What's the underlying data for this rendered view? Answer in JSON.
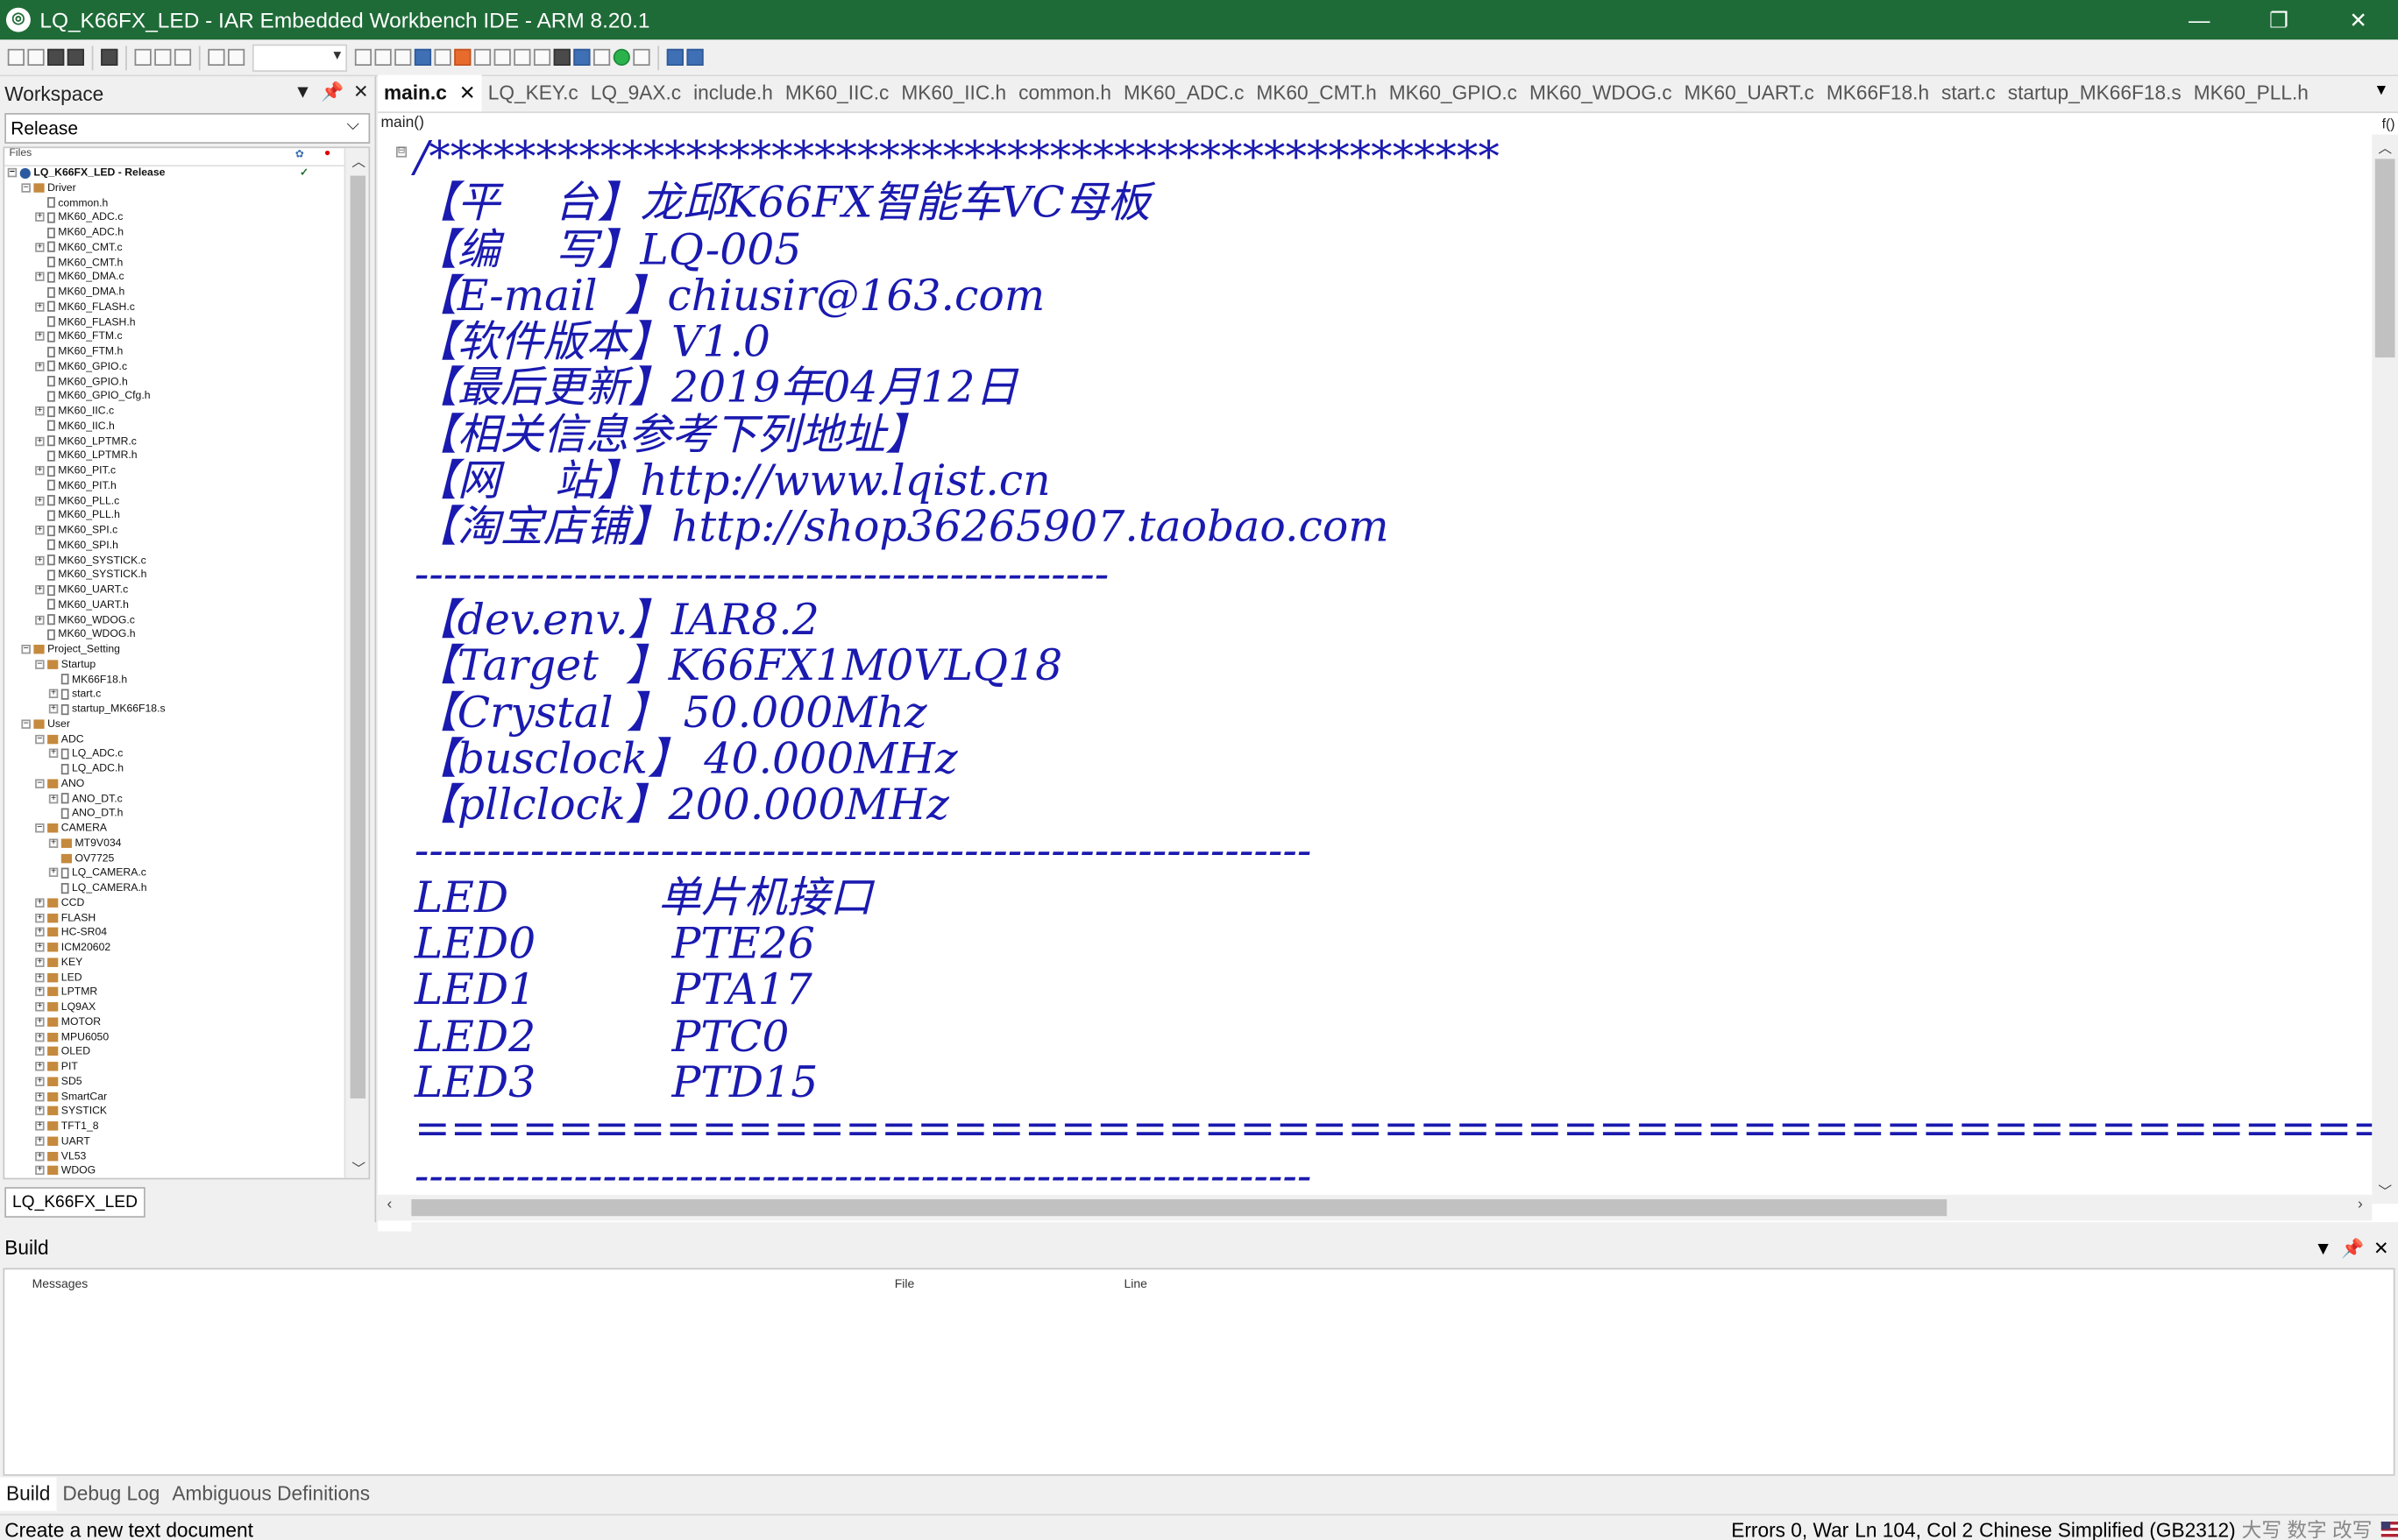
{
  "window": {
    "title": "LQ_K66FX_LED - IAR Embedded Workbench IDE - ARM 8.20.1",
    "controls": {
      "minimize": "—",
      "restore": "❐",
      "close": "✕"
    },
    "accent": "#1e6b37"
  },
  "workspace": {
    "title": "Workspace",
    "config": "Release",
    "files_header": "Files",
    "tab_label": "LQ_K66FX_LED",
    "tree": [
      {
        "label": "LQ_K66FX_LED - Release",
        "depth": 0,
        "kind": "project",
        "bold": true,
        "check": true
      },
      {
        "label": "Driver",
        "depth": 1,
        "kind": "folder",
        "exp": "⊟"
      },
      {
        "label": "common.h",
        "depth": 2,
        "kind": "doc"
      },
      {
        "label": "MK60_ADC.c",
        "depth": 2,
        "kind": "doc",
        "exp": "⊞"
      },
      {
        "label": "MK60_ADC.h",
        "depth": 2,
        "kind": "doc"
      },
      {
        "label": "MK60_CMT.c",
        "depth": 2,
        "kind": "doc",
        "exp": "⊞"
      },
      {
        "label": "MK60_CMT.h",
        "depth": 2,
        "kind": "doc"
      },
      {
        "label": "MK60_DMA.c",
        "depth": 2,
        "kind": "doc",
        "exp": "⊞"
      },
      {
        "label": "MK60_DMA.h",
        "depth": 2,
        "kind": "doc"
      },
      {
        "label": "MK60_FLASH.c",
        "depth": 2,
        "kind": "doc",
        "exp": "⊞"
      },
      {
        "label": "MK60_FLASH.h",
        "depth": 2,
        "kind": "doc"
      },
      {
        "label": "MK60_FTM.c",
        "depth": 2,
        "kind": "doc",
        "exp": "⊞"
      },
      {
        "label": "MK60_FTM.h",
        "depth": 2,
        "kind": "doc"
      },
      {
        "label": "MK60_GPIO.c",
        "depth": 2,
        "kind": "doc",
        "exp": "⊞"
      },
      {
        "label": "MK60_GPIO.h",
        "depth": 2,
        "kind": "doc"
      },
      {
        "label": "MK60_GPIO_Cfg.h",
        "depth": 2,
        "kind": "doc"
      },
      {
        "label": "MK60_IIC.c",
        "depth": 2,
        "kind": "doc",
        "exp": "⊞"
      },
      {
        "label": "MK60_IIC.h",
        "depth": 2,
        "kind": "doc"
      },
      {
        "label": "MK60_LPTMR.c",
        "depth": 2,
        "kind": "doc",
        "exp": "⊞"
      },
      {
        "label": "MK60_LPTMR.h",
        "depth": 2,
        "kind": "doc"
      },
      {
        "label": "MK60_PIT.c",
        "depth": 2,
        "kind": "doc",
        "exp": "⊞"
      },
      {
        "label": "MK60_PIT.h",
        "depth": 2,
        "kind": "doc"
      },
      {
        "label": "MK60_PLL.c",
        "depth": 2,
        "kind": "doc",
        "exp": "⊞"
      },
      {
        "label": "MK60_PLL.h",
        "depth": 2,
        "kind": "doc"
      },
      {
        "label": "MK60_SPI.c",
        "depth": 2,
        "kind": "doc",
        "exp": "⊞"
      },
      {
        "label": "MK60_SPI.h",
        "depth": 2,
        "kind": "doc"
      },
      {
        "label": "MK60_SYSTICK.c",
        "depth": 2,
        "kind": "doc",
        "exp": "⊞"
      },
      {
        "label": "MK60_SYSTICK.h",
        "depth": 2,
        "kind": "doc"
      },
      {
        "label": "MK60_UART.c",
        "depth": 2,
        "kind": "doc",
        "exp": "⊞"
      },
      {
        "label": "MK60_UART.h",
        "depth": 2,
        "kind": "doc"
      },
      {
        "label": "MK60_WDOG.c",
        "depth": 2,
        "kind": "doc",
        "exp": "⊞"
      },
      {
        "label": "MK60_WDOG.h",
        "depth": 2,
        "kind": "doc"
      },
      {
        "label": "Project_Setting",
        "depth": 1,
        "kind": "folder",
        "exp": "⊟"
      },
      {
        "label": "Startup",
        "depth": 2,
        "kind": "folder",
        "exp": "⊟"
      },
      {
        "label": "MK66F18.h",
        "depth": 3,
        "kind": "doc"
      },
      {
        "label": "start.c",
        "depth": 3,
        "kind": "doc",
        "exp": "⊞"
      },
      {
        "label": "startup_MK66F18.s",
        "depth": 3,
        "kind": "doc",
        "exp": "⊞"
      },
      {
        "label": "User",
        "depth": 1,
        "kind": "folder",
        "exp": "⊟"
      },
      {
        "label": "ADC",
        "depth": 2,
        "kind": "folder",
        "exp": "⊟"
      },
      {
        "label": "LQ_ADC.c",
        "depth": 3,
        "kind": "doc",
        "exp": "⊞"
      },
      {
        "label": "LQ_ADC.h",
        "depth": 3,
        "kind": "doc"
      },
      {
        "label": "ANO",
        "depth": 2,
        "kind": "folder",
        "exp": "⊟"
      },
      {
        "label": "ANO_DT.c",
        "depth": 3,
        "kind": "doc",
        "exp": "⊞"
      },
      {
        "label": "ANO_DT.h",
        "depth": 3,
        "kind": "doc"
      },
      {
        "label": "CAMERA",
        "depth": 2,
        "kind": "folder",
        "exp": "⊟"
      },
      {
        "label": "MT9V034",
        "depth": 3,
        "kind": "folder",
        "exp": "⊞"
      },
      {
        "label": "OV7725",
        "depth": 3,
        "kind": "folder"
      },
      {
        "label": "LQ_CAMERA.c",
        "depth": 3,
        "kind": "doc",
        "exp": "⊞"
      },
      {
        "label": "LQ_CAMERA.h",
        "depth": 3,
        "kind": "doc"
      },
      {
        "label": "CCD",
        "depth": 2,
        "kind": "folder",
        "exp": "⊞"
      },
      {
        "label": "FLASH",
        "depth": 2,
        "kind": "folder",
        "exp": "⊞"
      },
      {
        "label": "HC-SR04",
        "depth": 2,
        "kind": "folder",
        "exp": "⊞"
      },
      {
        "label": "ICM20602",
        "depth": 2,
        "kind": "folder",
        "exp": "⊞"
      },
      {
        "label": "KEY",
        "depth": 2,
        "kind": "folder",
        "exp": "⊞"
      },
      {
        "label": "LED",
        "depth": 2,
        "kind": "folder",
        "exp": "⊞"
      },
      {
        "label": "LPTMR",
        "depth": 2,
        "kind": "folder",
        "exp": "⊞"
      },
      {
        "label": "LQ9AX",
        "depth": 2,
        "kind": "folder",
        "exp": "⊞"
      },
      {
        "label": "MOTOR",
        "depth": 2,
        "kind": "folder",
        "exp": "⊞"
      },
      {
        "label": "MPU6050",
        "depth": 2,
        "kind": "folder",
        "exp": "⊞"
      },
      {
        "label": "OLED",
        "depth": 2,
        "kind": "folder",
        "exp": "⊞"
      },
      {
        "label": "PIT",
        "depth": 2,
        "kind": "folder",
        "exp": "⊞"
      },
      {
        "label": "SD5",
        "depth": 2,
        "kind": "folder",
        "exp": "⊞"
      },
      {
        "label": "SmartCar",
        "depth": 2,
        "kind": "folder",
        "exp": "⊞"
      },
      {
        "label": "SYSTICK",
        "depth": 2,
        "kind": "folder",
        "exp": "⊞"
      },
      {
        "label": "TFT1_8",
        "depth": 2,
        "kind": "folder",
        "exp": "⊞"
      },
      {
        "label": "UART",
        "depth": 2,
        "kind": "folder",
        "exp": "⊞"
      },
      {
        "label": "VL53",
        "depth": 2,
        "kind": "folder",
        "exp": "⊞"
      },
      {
        "label": "WDOG",
        "depth": 2,
        "kind": "folder",
        "exp": "⊞"
      }
    ]
  },
  "editor": {
    "tabs": [
      "main.c",
      "LQ_KEY.c",
      "LQ_9AX.c",
      "include.h",
      "MK60_IIC.c",
      "MK60_IIC.h",
      "common.h",
      "MK60_ADC.c",
      "MK60_CMT.h",
      "MK60_GPIO.c",
      "MK60_WDOG.c",
      "MK60_UART.c",
      "MK66F18.h",
      "start.c",
      "startup_MK66F18.s",
      "MK60_PLL.h"
    ],
    "active_tab": "main.c",
    "function_bar": "main()",
    "function_bar_right": "f()",
    "code_color": "#1a1ab0",
    "code_lines": [
      "/**************************************************",
      "【平    台】龙邱K66FX智能车VC母板",
      "【编    写】LQ-005",
      "【E-mail  】chiusir@163.com",
      "【软件版本】V1.0",
      "【最后更新】2019年04月12日",
      "【相关信息参考下列地址】",
      "【网    站】http://www.lqist.cn",
      "【淘宝店铺】http://shop36265907.taobao.com",
      "------------------------------------------------",
      "【dev.env.】IAR8.2",
      "【Target  】K66FX1M0VLQ18",
      "【Crystal 】 50.000Mhz",
      "【busclock】 40.000MHz",
      "【pllclock】200.000MHz",
      "--------------------------------------------------------------",
      "LED           单片机接口",
      "LED0          PTE26",
      "LED1          PTA17",
      "LED2          PTC0",
      "LED3          PTD15",
      "==============================================================",
      "--------------------------------------------------------------"
    ]
  },
  "build": {
    "title": "Build",
    "columns": [
      "Messages",
      "File",
      "Line"
    ]
  },
  "bottom_tabs": [
    "Build",
    "Debug Log",
    "Ambiguous Definitions"
  ],
  "status": {
    "left": "Create a new text document",
    "errors": "Errors 0, War",
    "position": "Ln 104, Col 2",
    "encoding": "Chinese Simplified (GB2312)",
    "ime": "大写 数字 改写"
  }
}
